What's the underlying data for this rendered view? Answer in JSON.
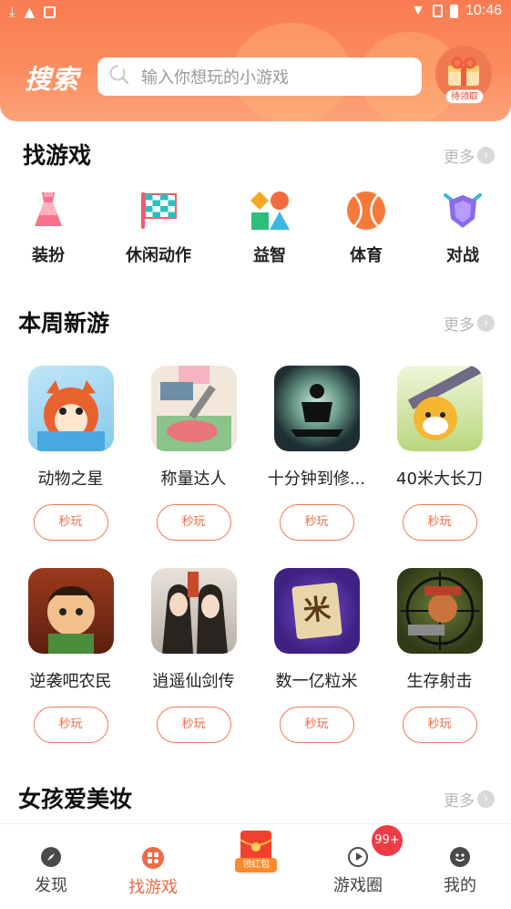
{
  "status_bar": {
    "time": "10:46"
  },
  "header": {
    "logo_text": "搜索",
    "search_placeholder": "输入你想玩的小游戏",
    "gift_badge": "待领取"
  },
  "find_games": {
    "title": "找游戏",
    "more_label": "更多",
    "categories": [
      {
        "label": "装扮",
        "icon": "dress-icon"
      },
      {
        "label": "休闲动作",
        "icon": "flag-icon"
      },
      {
        "label": "益智",
        "icon": "shapes-icon"
      },
      {
        "label": "体育",
        "icon": "ball-icon"
      },
      {
        "label": "对战",
        "icon": "shield-icon"
      }
    ]
  },
  "weekly_new": {
    "title": "本周新游",
    "more_label": "更多",
    "games": [
      {
        "name": "动物之星",
        "button": "秒玩"
      },
      {
        "name": "称量达人",
        "button": "秒玩"
      },
      {
        "name": "十分钟到修...",
        "button": "秒玩"
      },
      {
        "name": "40米大长刀",
        "button": "秒玩"
      },
      {
        "name": "逆袭吧农民",
        "button": "秒玩"
      },
      {
        "name": "逍遥仙剑传",
        "button": "秒玩"
      },
      {
        "name": "数一亿粒米",
        "button": "秒玩"
      },
      {
        "name": "生存射击",
        "button": "秒玩"
      }
    ],
    "game3_tile_text": "米"
  },
  "girls_makeup": {
    "title": "女孩爱美妆",
    "more_label": "更多"
  },
  "bottom_nav": {
    "items": [
      {
        "label": "发现",
        "icon": "compass-icon"
      },
      {
        "label": "找游戏",
        "icon": "gamepad-icon"
      },
      {
        "label": "游戏圈",
        "icon": "play-circle-icon"
      },
      {
        "label": "我的",
        "icon": "smile-icon"
      }
    ],
    "redpack_label": "领红包",
    "circle_badge": "99+",
    "active_color": "#f06a43"
  },
  "colors": {
    "accent": "#f97b52",
    "button_border": "#f07a5b"
  }
}
